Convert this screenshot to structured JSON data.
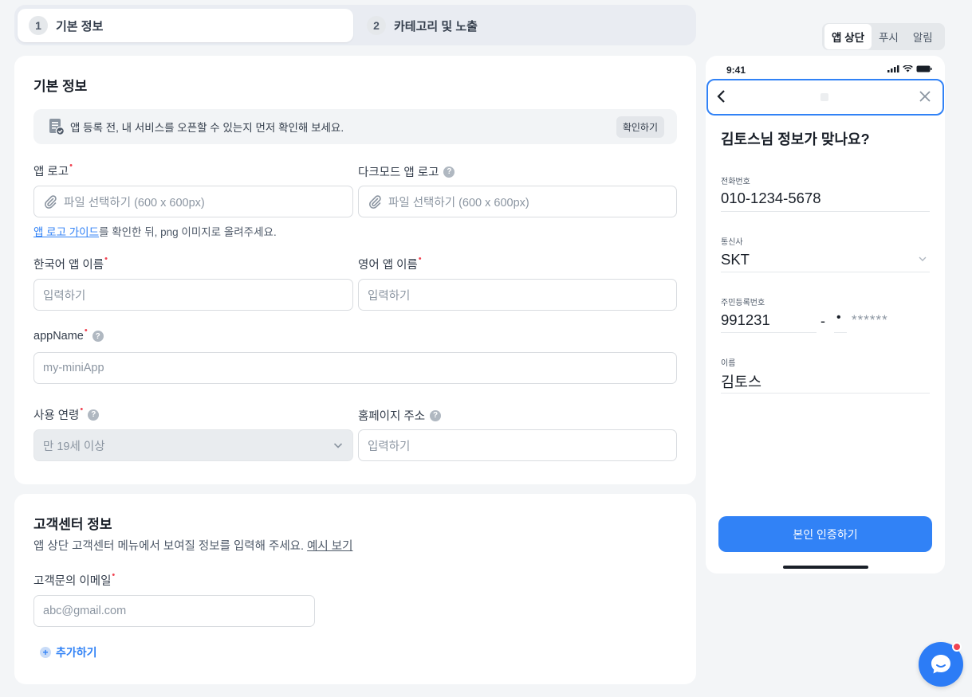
{
  "stepper": {
    "steps": [
      {
        "num": "1",
        "label": "기본 정보"
      },
      {
        "num": "2",
        "label": "카테고리 및 노출"
      }
    ]
  },
  "basic": {
    "title": "기본 정보",
    "notice_text": "앱 등록 전, 내 서비스를 오픈할 수 있는지 먼저 확인해 보세요.",
    "notice_button": "확인하기",
    "app_logo_label": "앱 로고",
    "dark_logo_label": "다크모드 앱 로고",
    "file_placeholder": "파일 선택하기 (600 x 600px)",
    "logo_hint_link": "앱 로고 가이드",
    "logo_hint_rest": "를 확인한 뒤, png 이미지로 올려주세요.",
    "kr_name_label": "한국어 앱 이름",
    "en_name_label": "영어 앱 이름",
    "input_placeholder": "입력하기",
    "appname_label": "appName",
    "appname_placeholder": "my-miniApp",
    "age_label": "사용 연령",
    "age_value": "만 19세 이상",
    "homepage_label": "홈페이지 주소"
  },
  "support": {
    "title": "고객센터 정보",
    "desc": "앱 상단 고객센터 메뉴에서 보여질 정보를 입력해 주세요.",
    "desc_link": "예시 보기",
    "email_label": "고객문의 이메일",
    "email_placeholder": "abc@gmail.com",
    "add_label": "추가하기"
  },
  "preview_tabs": [
    "앱 상단",
    "푸시",
    "알림"
  ],
  "phone": {
    "time": "9:41",
    "title": "김토스님 정보가 맞나요?",
    "phone_label": "전화번호",
    "phone_value": "010-1234-5678",
    "carrier_label": "통신사",
    "carrier_value": "SKT",
    "rrn_label": "주민등록번호",
    "rrn_front": "991231",
    "rrn_dash": "-",
    "rrn_dot": "•",
    "rrn_mask": "******",
    "name_label": "이름",
    "name_value": "김토스",
    "button": "본인 인증하기"
  },
  "colors": {
    "accent": "#3182f6",
    "required": "#f04452"
  }
}
